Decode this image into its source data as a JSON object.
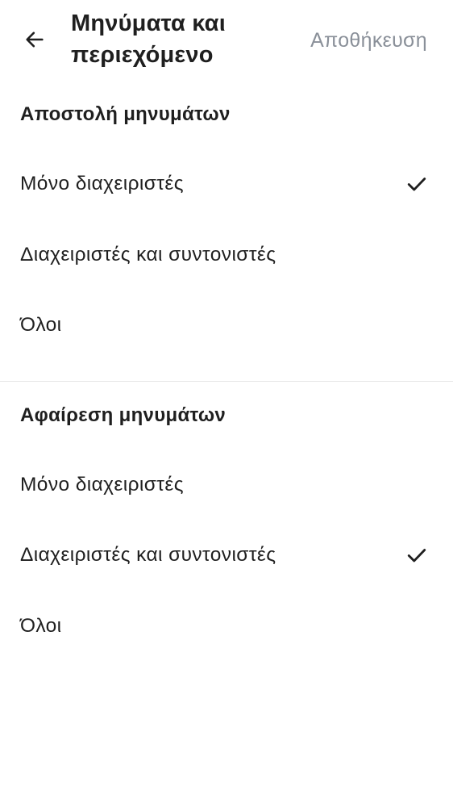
{
  "header": {
    "title": "Μηνύματα και περιεχόμενο",
    "save_label": "Αποθήκευση",
    "back_icon": "arrow-left-icon"
  },
  "sections": [
    {
      "title": "Αποστολή μηνυμάτων",
      "options": [
        {
          "label": "Μόνο διαχειριστές",
          "selected": true
        },
        {
          "label": "Διαχειριστές και συντονιστές",
          "selected": false
        },
        {
          "label": "Όλοι",
          "selected": false
        }
      ]
    },
    {
      "title": "Αφαίρεση μηνυμάτων",
      "options": [
        {
          "label": "Μόνο διαχειριστές",
          "selected": false
        },
        {
          "label": "Διαχειριστές και συντονιστές",
          "selected": true
        },
        {
          "label": "Όλοι",
          "selected": false
        }
      ]
    }
  ],
  "colors": {
    "text": "#1f1f1f",
    "save_disabled": "#8a9099",
    "divider": "#e6e6e6"
  }
}
